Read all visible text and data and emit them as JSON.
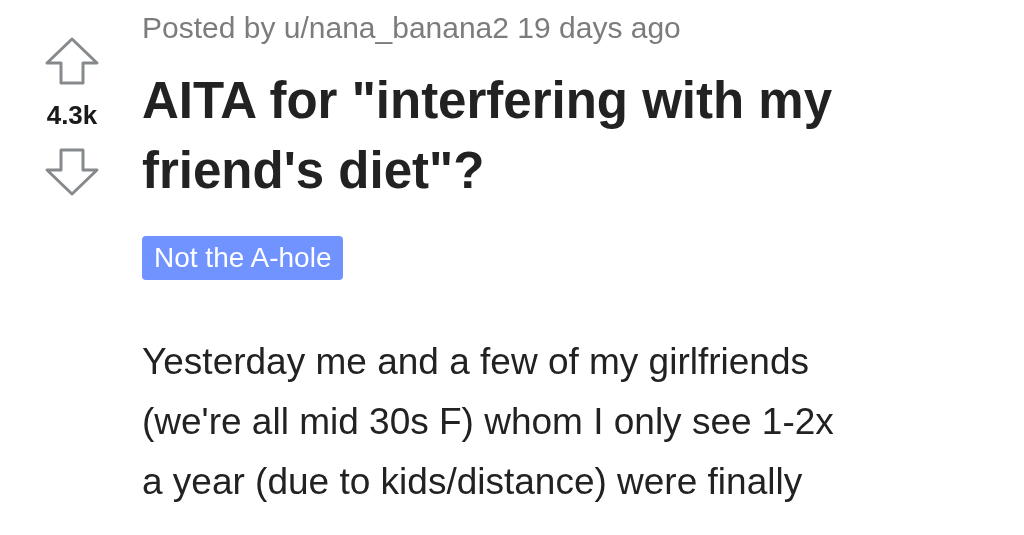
{
  "post": {
    "meta": "Posted by u/nana_banana2 19 days ago",
    "score": "4.3k",
    "title": "AITA for \"interfering with my friend's diet\"?",
    "flair": {
      "label": "Not the A-hole",
      "color": "#7193ff"
    },
    "body": "Yesterday me and a few of my girlfriends\n(we're all mid 30s F) whom I only see 1-2x\na year (due to kids/distance) were finally"
  }
}
